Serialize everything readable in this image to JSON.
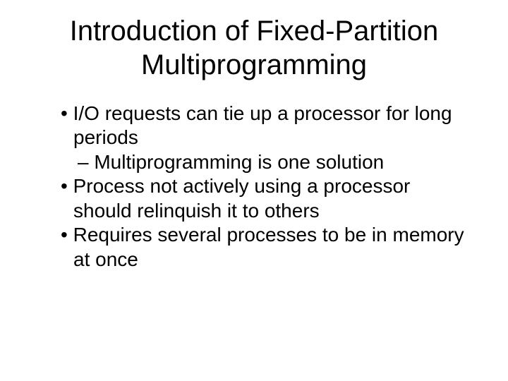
{
  "title": "Introduction of Fixed-Partition Multiprogramming",
  "bullets": {
    "b1": "I/O requests can tie up a processor for long periods",
    "b1a": "Multiprogramming is one solution",
    "b2": "Process not actively using a processor should relinquish it to others",
    "b3": "Requires several processes to be in memory at once"
  },
  "markers": {
    "dot": "•",
    "dash": "–"
  }
}
